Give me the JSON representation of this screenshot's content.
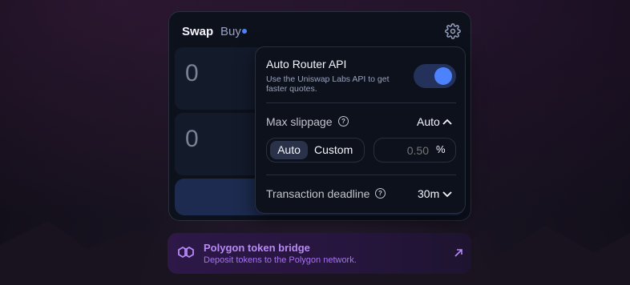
{
  "swap": {
    "tabs": {
      "swap": "Swap",
      "buy": "Buy"
    },
    "input_amount": "0",
    "output_amount": "0"
  },
  "settings": {
    "auto_router": {
      "title": "Auto Router API",
      "description": "Use the Uniswap Labs API to get faster quotes.",
      "enabled": true
    },
    "max_slippage": {
      "label": "Max slippage",
      "value": "Auto",
      "options": [
        "Auto",
        "Custom"
      ],
      "custom_placeholder": "0.50",
      "unit": "%"
    },
    "deadline": {
      "label": "Transaction deadline",
      "value": "30m"
    }
  },
  "banner": {
    "title": "Polygon token bridge",
    "subtitle": "Deposit tokens to the Polygon network."
  },
  "icons": [
    "gear-icon",
    "help-icon",
    "chevron-up-icon",
    "chevron-down-icon",
    "polygon-logo-icon",
    "external-arrow-icon"
  ],
  "colors": {
    "accent": "#4c82fb",
    "background": "#0d111c",
    "banner_text": "#b78af7"
  }
}
